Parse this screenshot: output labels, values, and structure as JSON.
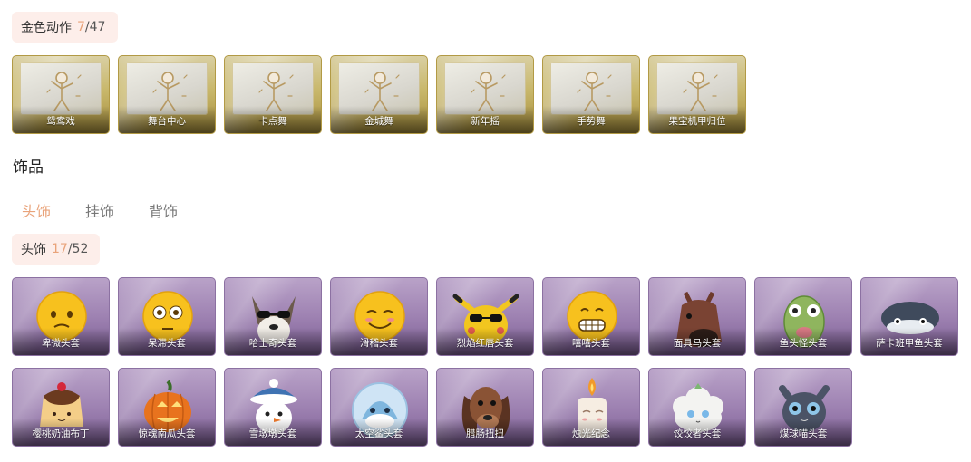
{
  "gold_actions": {
    "title": "金色动作",
    "owned": "7",
    "separator": "/",
    "total": "47",
    "items": [
      {
        "label": "鸳鸯戏",
        "icon": "dance-pose-icon"
      },
      {
        "label": "舞台中心",
        "icon": "dance-pose-icon"
      },
      {
        "label": "卡点舞",
        "icon": "dance-pose-icon"
      },
      {
        "label": "金城舞",
        "icon": "dance-pose-icon"
      },
      {
        "label": "新年摇",
        "icon": "dance-pose-icon"
      },
      {
        "label": "手势舞",
        "icon": "dance-pose-icon"
      },
      {
        "label": "果宝机甲归位",
        "icon": "dance-pose-icon"
      }
    ]
  },
  "accessories": {
    "section_title": "饰品",
    "tabs": [
      {
        "label": "头饰",
        "active": true
      },
      {
        "label": "挂饰",
        "active": false
      },
      {
        "label": "背饰",
        "active": false
      }
    ],
    "counter": {
      "title": "头饰",
      "owned": "17",
      "separator": "/",
      "total": "52"
    },
    "items": [
      {
        "label": "卑微头套",
        "icon": "shy-emoji-icon"
      },
      {
        "label": "呆滞头套",
        "icon": "dazed-emoji-icon"
      },
      {
        "label": "哈士奇头套",
        "icon": "husky-icon"
      },
      {
        "label": "滑稽头套",
        "icon": "funny-emoji-icon"
      },
      {
        "label": "烈焰红唇头套",
        "icon": "pikachu-sunglasses-icon"
      },
      {
        "label": "嘻嘻头套",
        "icon": "grin-emoji-icon"
      },
      {
        "label": "面具马头套",
        "icon": "horse-mask-icon"
      },
      {
        "label": "鱼头怪头套",
        "icon": "fish-head-icon"
      },
      {
        "label": "萨卡班甲鱼头套",
        "icon": "sacabambaspis-icon"
      },
      {
        "label": "樱桃奶油布丁",
        "icon": "pudding-icon"
      },
      {
        "label": "惊魂南瓜头套",
        "icon": "pumpkin-icon"
      },
      {
        "label": "雪墩墩头套",
        "icon": "snowman-icon"
      },
      {
        "label": "太空鲨头套",
        "icon": "space-shark-icon"
      },
      {
        "label": "腊肠扭扭",
        "icon": "dachshund-icon"
      },
      {
        "label": "烛光纪念",
        "icon": "candle-icon"
      },
      {
        "label": "饺饺者头套",
        "icon": "dumpling-icon"
      },
      {
        "label": "煤球喵头套",
        "icon": "black-cat-icon"
      }
    ]
  },
  "colors": {
    "accent": "#e9a37a",
    "pill_bg": "#fdeeea"
  }
}
